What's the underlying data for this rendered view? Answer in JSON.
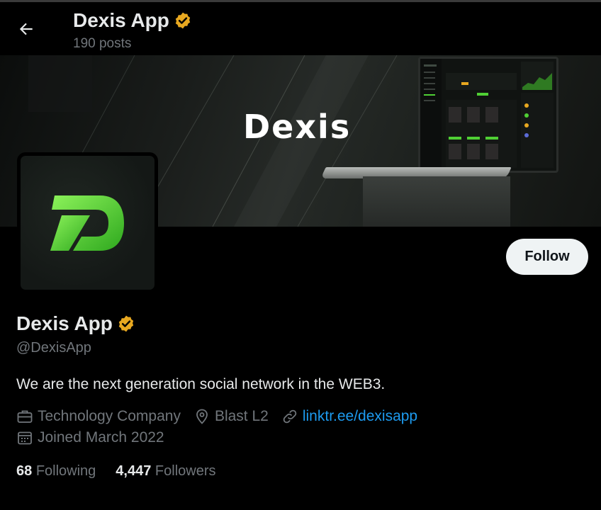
{
  "header": {
    "title": "Dexis App",
    "posts": "190 posts",
    "back_icon": "arrow-left-icon"
  },
  "banner": {
    "word": "Dexis"
  },
  "profile": {
    "display_name": "Dexis App",
    "handle": "@DexisApp",
    "bio": "We are the next generation social network in the WEB3.",
    "verified_badge_color": "#e8a820",
    "category": "Technology Company",
    "location": "Blast L2",
    "website": "linktr.ee/dexisapp",
    "joined": "Joined March 2022",
    "following_count": "68",
    "following_label": "Following",
    "followers_count": "4,447",
    "followers_label": "Followers"
  },
  "actions": {
    "follow_label": "Follow"
  },
  "colors": {
    "background": "#000000",
    "link": "#1d9bf0",
    "secondary_text": "#71767b",
    "brand_green": "#5de13a"
  }
}
